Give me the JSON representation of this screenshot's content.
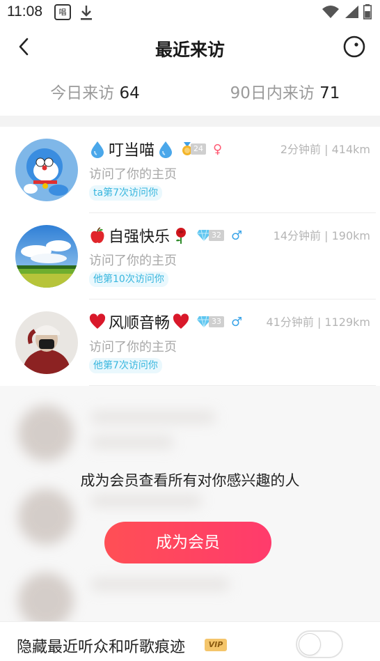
{
  "status_bar": {
    "time": "11:08",
    "app_icon_text": "唱",
    "icons": [
      "app-notification-icon",
      "download-icon",
      "wifi-icon",
      "signal-icon",
      "battery-icon"
    ]
  },
  "header": {
    "title": "最近来访",
    "back_icon": "chevron-left-icon",
    "more_icon": "circle-dot-icon"
  },
  "tabs": [
    {
      "label": "今日来访",
      "count": "64"
    },
    {
      "label": "90日内来访",
      "count": "71"
    }
  ],
  "visitors": [
    {
      "prefix_emoji": "water-drop-emoji",
      "name": "叮当喵",
      "suffix_emoji": "water-drop-emoji",
      "badge_icon": "medal-icon",
      "level": "24",
      "gender_symbol": "♀",
      "gender": "female",
      "time": "2分钟前",
      "distance": "414km",
      "action": "访问了你的主页",
      "visit_tag": "ta第7次访问你"
    },
    {
      "prefix_emoji": "apple-emoji",
      "name": "自强快乐",
      "suffix_emoji": "rose-emoji",
      "badge_icon": "diamond-icon",
      "level": "32",
      "gender_symbol": "♂",
      "gender": "male",
      "time": "14分钟前",
      "distance": "190km",
      "action": "访问了你的主页",
      "visit_tag": "他第10次访问你"
    },
    {
      "prefix_emoji": "heart-emoji",
      "name": "风顺音畅",
      "suffix_emoji": "heart-emoji",
      "badge_icon": "diamond-icon",
      "level": "33",
      "gender_symbol": "♂",
      "gender": "male",
      "time": "41分钟前",
      "distance": "1129km",
      "action": "访问了你的主页",
      "visit_tag": "他第7次访问你"
    }
  ],
  "locked": {
    "message": "成为会员查看所有对你感兴趣的人",
    "button_label": "成为会员"
  },
  "bottom": {
    "label": "隐藏最近听众和听歌痕迹",
    "vip_badge": "VIP",
    "toggle_on": false
  },
  "colors": {
    "accent_start": "#ff4f55",
    "accent_end": "#ff3b6c",
    "tag_text": "#38b6de",
    "male": "#3aa4e8",
    "female": "#ff5a73"
  }
}
